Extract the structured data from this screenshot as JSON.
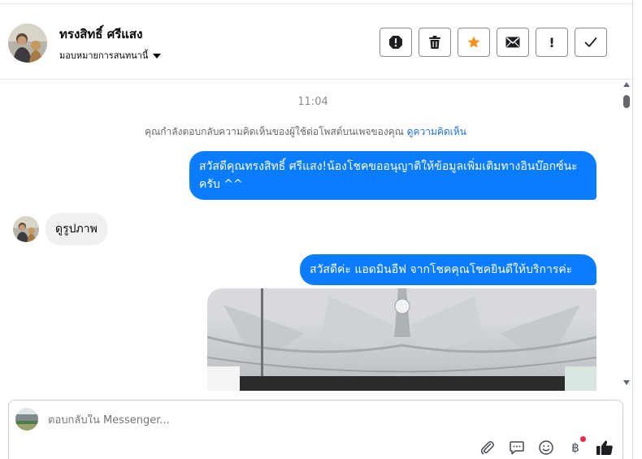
{
  "header": {
    "contact_name": "ทรงสิทธิ์ ศรีแสง",
    "assign_label": "มอบหมายการสนทนานี้",
    "actions": [
      {
        "name": "spam-button",
        "icon": "octagon-exclamation-icon"
      },
      {
        "name": "delete-button",
        "icon": "trash-icon"
      },
      {
        "name": "star-button",
        "icon": "star-icon",
        "color": "#f5921b"
      },
      {
        "name": "mark-unread-button",
        "icon": "envelope-icon"
      },
      {
        "name": "follow-up-button",
        "icon": "exclamation-icon",
        "label": "!"
      },
      {
        "name": "done-button",
        "icon": "checkmark-icon"
      }
    ]
  },
  "thread": {
    "timestamp": "11:04",
    "notice": "คุณกำลังตอบกลับความคิดเห็นของผู้ใช้ต่อโพสต์บนเพจของคุณ",
    "notice_link": "ดูความคิดเห็น",
    "messages": [
      {
        "from": "page",
        "text": "สวัสดีคุณทรงสิทธิ์ ศรีแสง!น้องโชคขออนุญาติให้ข้อมูลเพิ่มเติมทางอินบ๊อกซ์นะครับ ^^"
      },
      {
        "from": "user",
        "text": "ดูรูปภาพ"
      },
      {
        "from": "page",
        "text": "สวัสดีค่ะ แอดมินอีฟ จากโชคคุณโชคยินดีให้บริการค่ะ"
      },
      {
        "from": "page",
        "type": "photo"
      }
    ]
  },
  "composer": {
    "placeholder": "ตอบกลับใน Messenger...",
    "tools": [
      "paperclip-icon",
      "speech-bubble-icon",
      "smiley-icon",
      "baht-icon",
      "thumbs-up-icon"
    ],
    "baht_symbol": "฿"
  },
  "colors": {
    "accent": "#0a7cff",
    "link": "#216fdb",
    "incoming_bubble": "#f0f0f0",
    "star": "#f5921b",
    "badge": "#f02849"
  }
}
